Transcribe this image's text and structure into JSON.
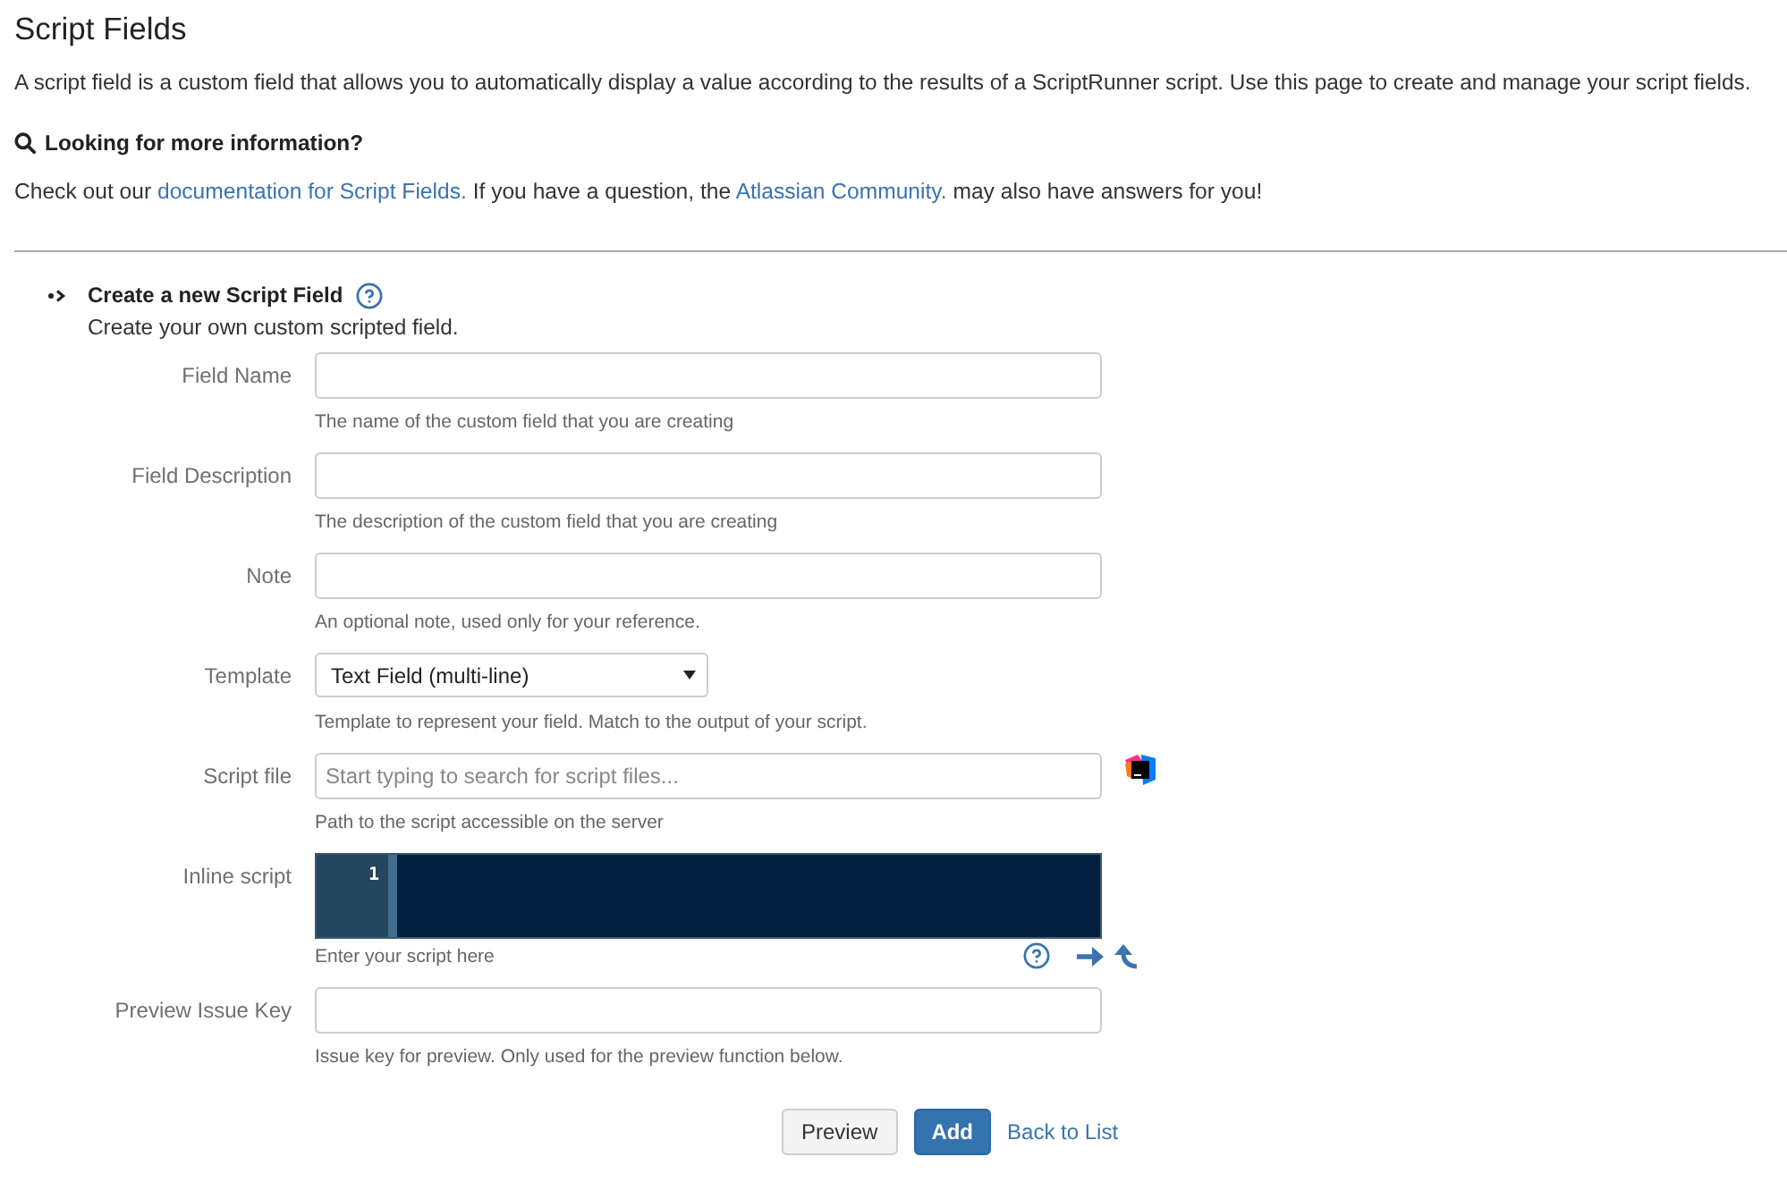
{
  "page": {
    "title": "Script Fields",
    "description": "A script field is a custom field that allows you to automatically display a value according to the results of a ScriptRunner script. Use this page to create and manage your script fields."
  },
  "info": {
    "heading": "Looking for more information?",
    "parts": [
      {
        "kind": "text",
        "text": "Check out our "
      },
      {
        "kind": "link",
        "text": "documentation for Script Fields."
      },
      {
        "kind": "text",
        "text": " If you have a question, the "
      },
      {
        "kind": "link",
        "text": "Atlassian Community."
      },
      {
        "kind": "text",
        "text": " may also have answers for you!"
      }
    ]
  },
  "form": {
    "heading": "Create a new Script Field",
    "subheading": "Create your own custom scripted field.",
    "fields": [
      {
        "kind": "text",
        "label": "Field Name",
        "hint": "The name of the custom field that you are creating"
      },
      {
        "kind": "text",
        "label": "Field Description",
        "hint": "The description of the custom field that you are creating"
      },
      {
        "kind": "text",
        "label": "Note",
        "hint": "An optional note, used only for your reference."
      },
      {
        "kind": "select",
        "label": "Template",
        "value": "Text Field (multi-line)",
        "hint": "Template to represent your field. Match to the output of your script."
      },
      {
        "kind": "file",
        "label": "Script file",
        "placeholder": "Start typing to search for script files...",
        "hint": "Path to the script accessible on the server"
      },
      {
        "kind": "code",
        "label": "Inline script",
        "line_numbers": [
          "1"
        ],
        "hint": "Enter your script here"
      },
      {
        "kind": "text",
        "label": "Preview Issue Key",
        "hint": "Issue key for preview. Only used for the preview function below."
      }
    ],
    "buttons": [
      {
        "kind": "secondary",
        "label": "Preview"
      },
      {
        "kind": "primary",
        "label": "Add"
      },
      {
        "kind": "link",
        "label": "Back to List"
      }
    ]
  }
}
